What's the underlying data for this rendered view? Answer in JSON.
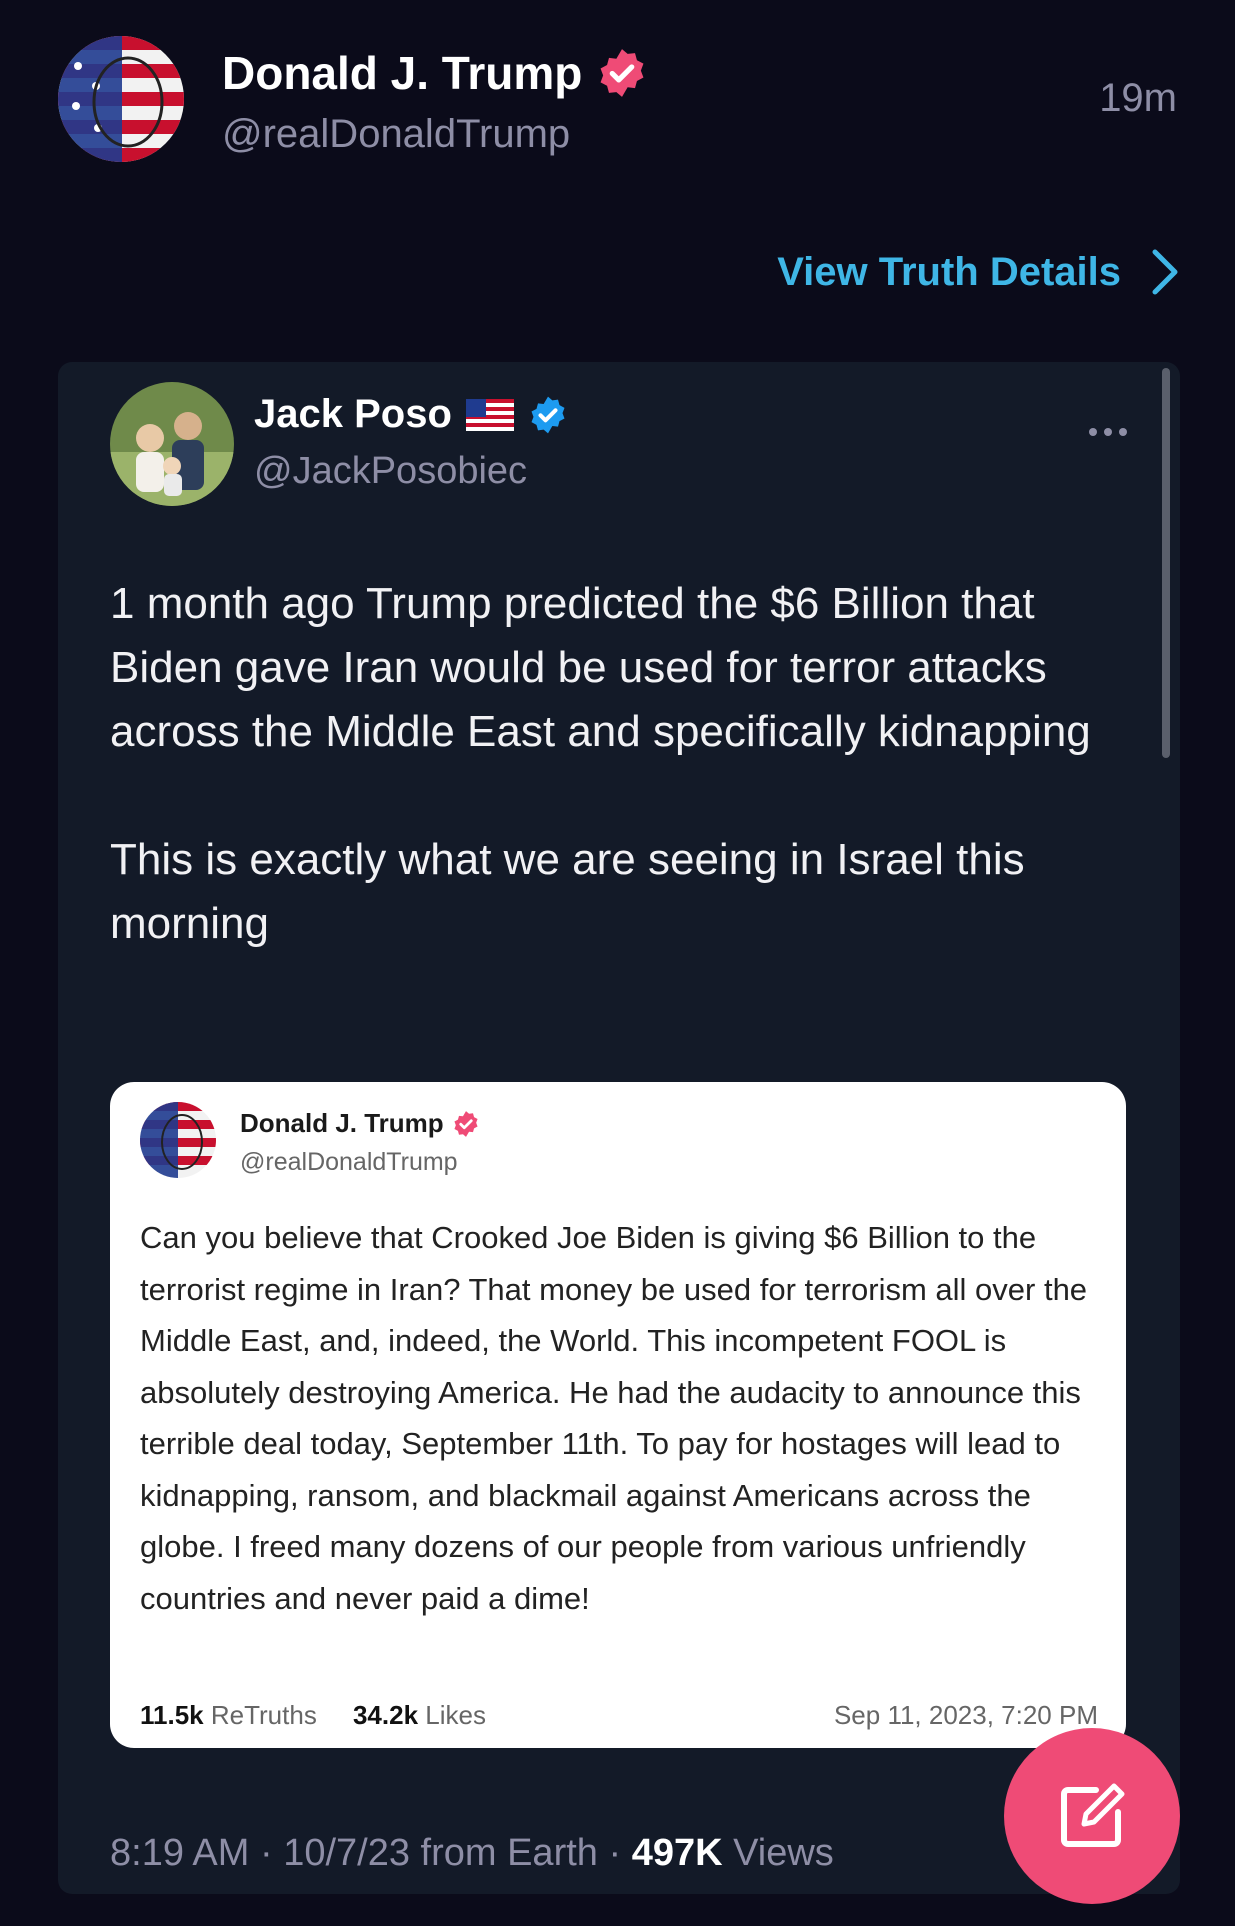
{
  "header": {
    "name": "Donald J. Trump",
    "handle": "@realDonaldTrump",
    "time": "19m",
    "details_link": "View Truth Details"
  },
  "quoted_post": {
    "name": "Jack Poso",
    "handle": "@JackPosobiec",
    "paragraphs": [
      "1 month ago Trump predicted the $6 Billion that Biden gave Iran would be used for terror attacks across the Middle East and specifically kidnapping",
      "This is exactly what we are seeing in Israel this morning"
    ],
    "meta_prefix": "8:19 AM · 10/7/23 from Earth · ",
    "views_count": "497K",
    "views_label": " Views"
  },
  "embedded_post": {
    "name": "Donald J. Trump",
    "handle": "@realDonaldTrump",
    "text": "Can you believe that Crooked Joe Biden is giving $6 Billion to the terrorist regime in Iran? That money be used for terrorism all over the Middle East, and, indeed, the World. This incompetent FOOL is absolutely destroying America. He had the audacity to announce this terrible deal today, September 11th. To pay for hostages will lead to kidnapping, ransom, and blackmail against Americans across the globe. I freed many dozens of our people from various unfriendly countries and never paid a dime!",
    "retruths_count": "11.5k",
    "retruths_label": "ReTruths",
    "likes_count": "34.2k",
    "likes_label": "Likes",
    "date": "Sep 11, 2023, 7:20 PM"
  },
  "icons": {
    "verified_truth": "pink-verified-badge-icon",
    "verified_x": "blue-verified-badge-icon",
    "flag": "us-flag-icon",
    "more": "more-dots-icon",
    "chevron": "chevron-right-icon",
    "compose": "compose-edit-icon"
  },
  "colors": {
    "background": "#0b0b1a",
    "card": "#131a28",
    "link": "#3fb6e6",
    "accent_pink": "#ef4b76",
    "verified_blue": "#1d9bf0",
    "muted": "#8e8ea6"
  }
}
